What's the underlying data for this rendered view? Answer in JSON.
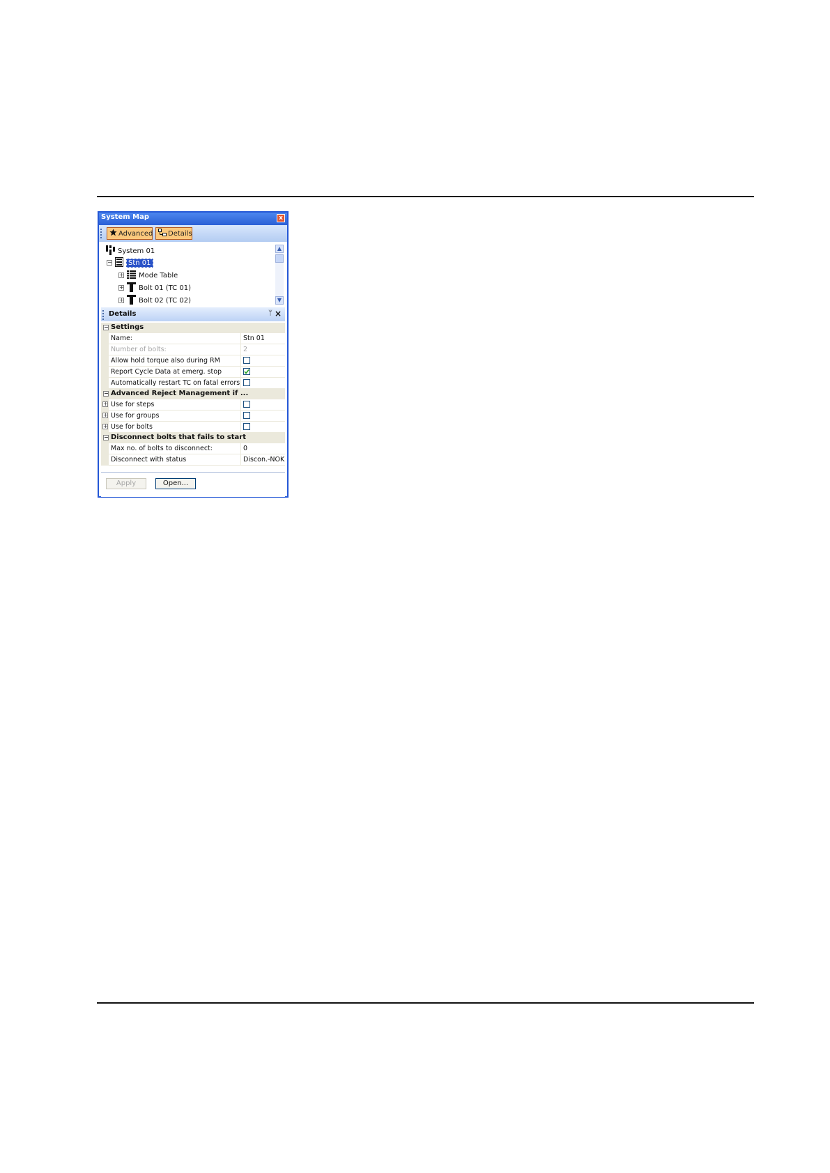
{
  "window": {
    "title": "System Map",
    "close_label": "x"
  },
  "toolbar": {
    "advanced_label": "Advanced",
    "details_label": "Details"
  },
  "tree": {
    "items": [
      {
        "label": "System 01"
      },
      {
        "label": "Stn 01",
        "selected": true
      },
      {
        "label": "Mode Table"
      },
      {
        "label": "Bolt 01 (TC 01)"
      },
      {
        "label": "Bolt 02 (TC 02)"
      }
    ]
  },
  "details": {
    "title": "Details",
    "pin_glyph": "ᛘ",
    "close_glyph": "×",
    "categories": [
      {
        "label": "Settings"
      },
      {
        "label": "Advanced Reject Management if ..."
      },
      {
        "label": "Disconnect bolts that fails to start"
      }
    ],
    "rows": [
      {
        "name": "Name:",
        "value": "Stn 01"
      },
      {
        "name": "Number of bolts:",
        "value": "2"
      },
      {
        "name": "Allow hold torque also during RM",
        "checked": false
      },
      {
        "name": "Report Cycle Data at emerg. stop",
        "checked": true
      },
      {
        "name": "Automatically restart TC on fatal errors",
        "checked": false
      },
      {
        "name": "Use for steps",
        "checked": false
      },
      {
        "name": "Use for groups",
        "checked": false
      },
      {
        "name": "Use for bolts",
        "checked": false
      },
      {
        "name": "Max no. of bolts to disconnect:",
        "value": "0"
      },
      {
        "name": "Disconnect with status",
        "value": "Discon.-NOK"
      }
    ]
  },
  "footer": {
    "apply_label": "Apply",
    "open_label": "Open..."
  },
  "colors": {
    "titlebar": "#2a5fd6",
    "toolbar_button": "#fbc87c",
    "selection": "#2952c8",
    "category_bg": "#ebe9dc"
  }
}
